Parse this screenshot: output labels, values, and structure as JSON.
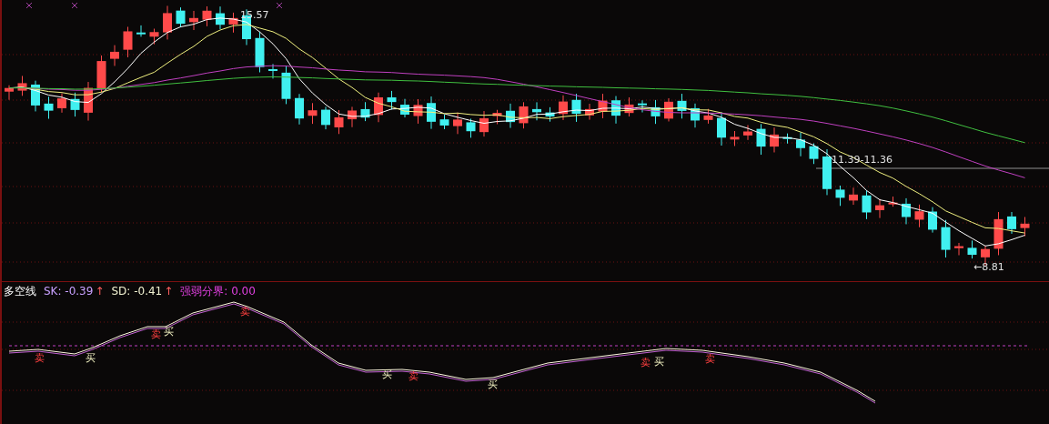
{
  "price_chart": {
    "annotations": [
      {
        "kind": "high",
        "text": "15.57"
      },
      {
        "kind": "level",
        "text": "11.39-11.36"
      },
      {
        "kind": "low",
        "text": "←8.81"
      }
    ]
  },
  "indicator": {
    "title": "多空线",
    "legend": [
      {
        "label": "SK: -0.39",
        "arrow": "↑",
        "color": "#c8a0ff"
      },
      {
        "label": "SD: -0.41",
        "arrow": "↑",
        "color": "#f0f0d0"
      },
      {
        "label": "强弱分界: 0.00",
        "color": "#e040e0"
      }
    ],
    "signals": [
      {
        "kind": "sell",
        "text": "卖"
      },
      {
        "kind": "buy",
        "text": "买"
      },
      {
        "kind": "sell",
        "text": "卖"
      },
      {
        "kind": "buy",
        "text": "买"
      },
      {
        "kind": "sell",
        "text": "卖"
      },
      {
        "kind": "buy",
        "text": "买"
      },
      {
        "kind": "sell",
        "text": "卖"
      },
      {
        "kind": "buy",
        "text": "买"
      },
      {
        "kind": "sell",
        "text": "卖"
      },
      {
        "kind": "buy",
        "text": "买"
      },
      {
        "kind": "sell",
        "text": "卖"
      }
    ]
  }
}
